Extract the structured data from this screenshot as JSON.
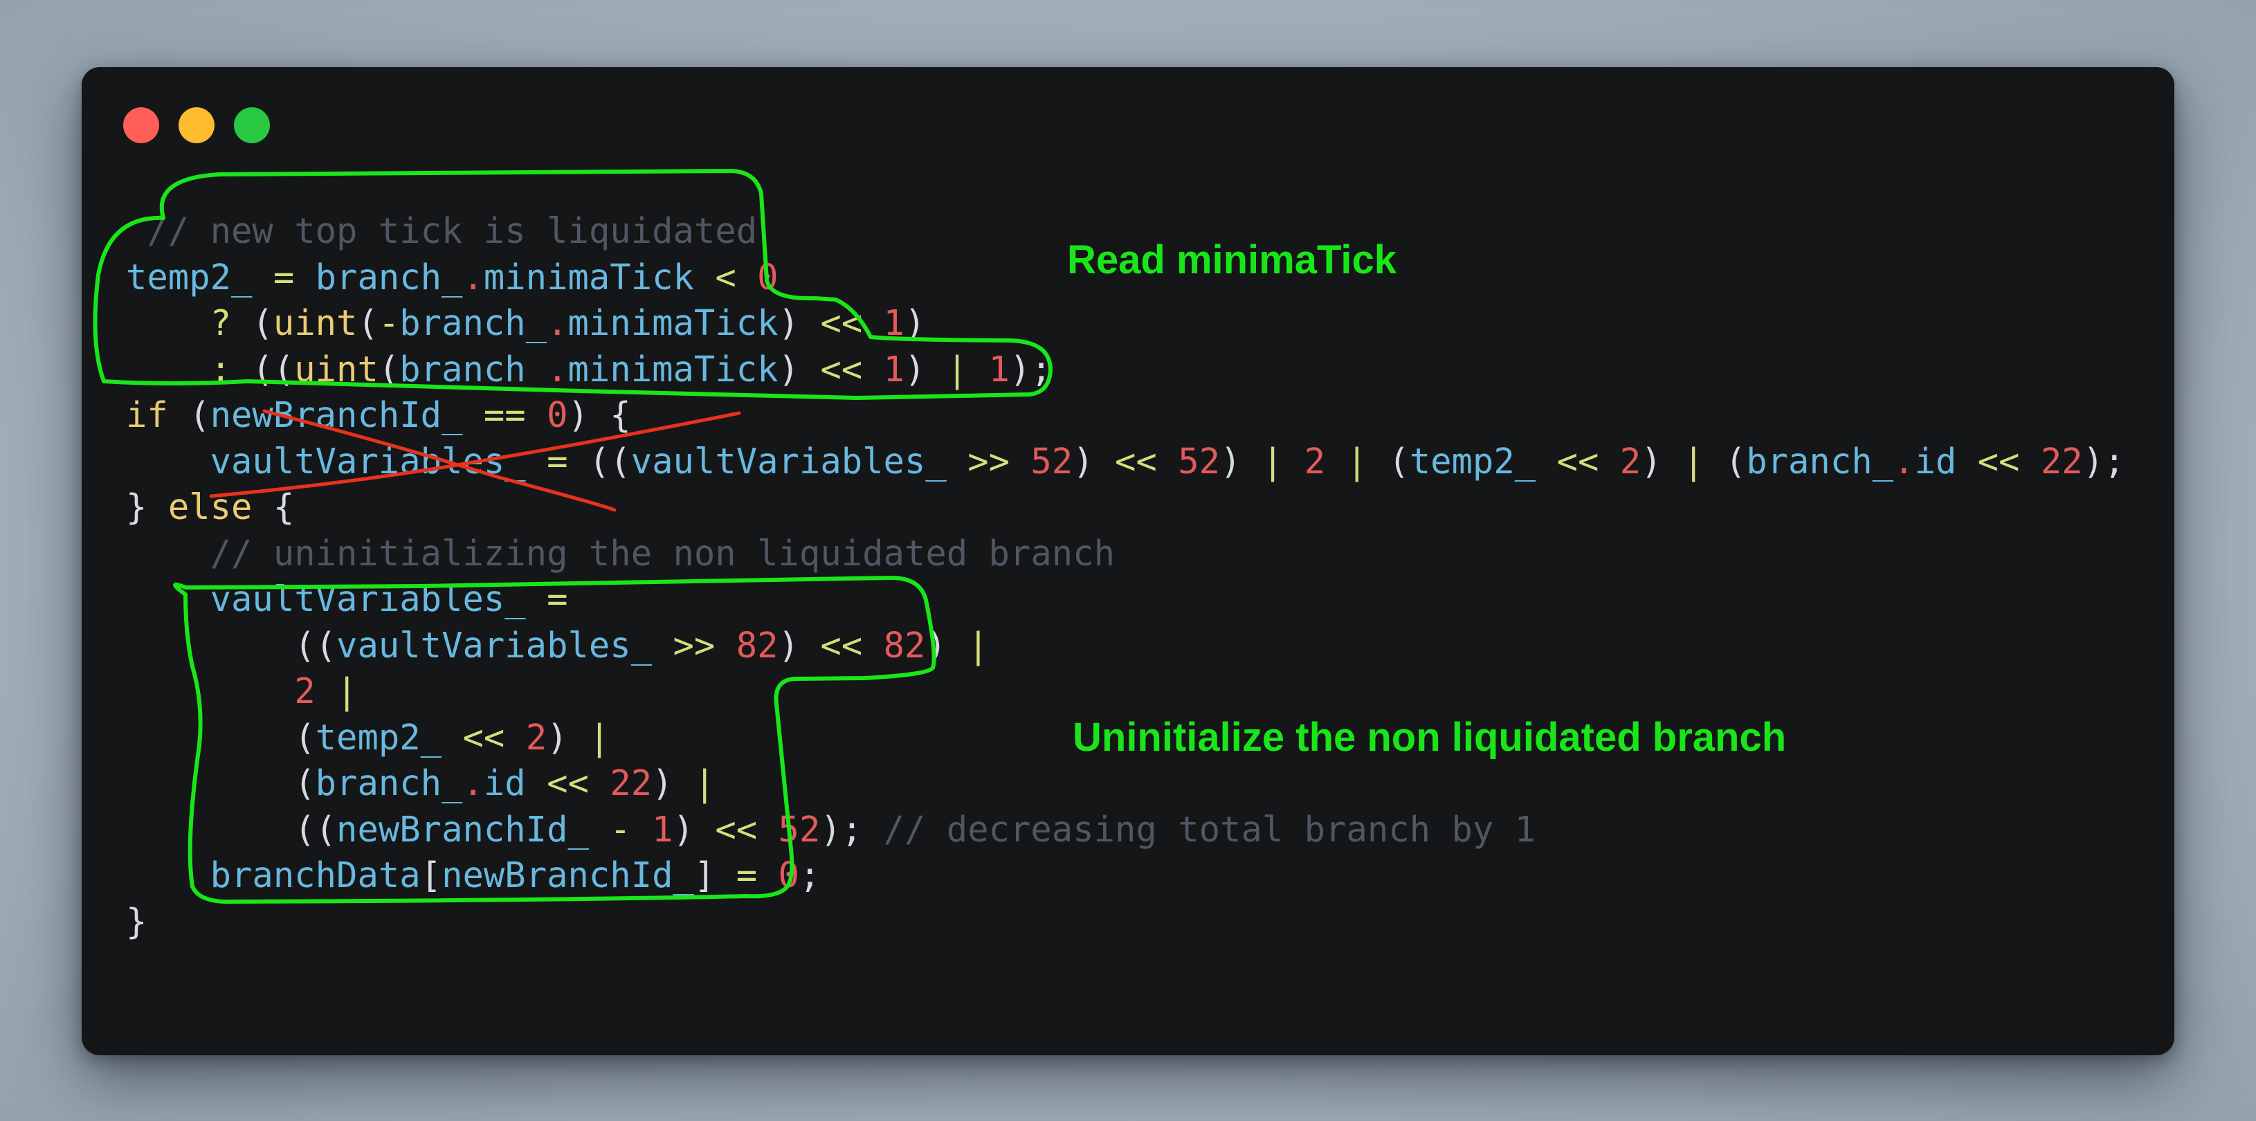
{
  "window": {
    "controls": [
      {
        "name": "close",
        "color": "#ff5f57"
      },
      {
        "name": "minimize",
        "color": "#febc2e"
      },
      {
        "name": "zoom",
        "color": "#28c840"
      }
    ]
  },
  "colors": {
    "annotation_green": "#19e619",
    "strike_red": "#e8321e"
  },
  "code": {
    "lines": [
      [
        [
          "cm",
          " // new top tick is liquidated"
        ]
      ],
      [
        [
          "id",
          "temp2_"
        ],
        [
          "pu",
          " "
        ],
        [
          "op",
          "="
        ],
        [
          "pu",
          " "
        ],
        [
          "id",
          "branch_"
        ],
        [
          "dt",
          "."
        ],
        [
          "id",
          "minimaTick"
        ],
        [
          "pu",
          " "
        ],
        [
          "op",
          "<"
        ],
        [
          "pu",
          " "
        ],
        [
          "nm",
          "0"
        ]
      ],
      [
        [
          "pu",
          "    "
        ],
        [
          "op",
          "?"
        ],
        [
          "pu",
          " ("
        ],
        [
          "fn",
          "uint"
        ],
        [
          "pu",
          "("
        ],
        [
          "op",
          "-"
        ],
        [
          "id",
          "branch_"
        ],
        [
          "dt",
          "."
        ],
        [
          "id",
          "minimaTick"
        ],
        [
          "pu",
          ") "
        ],
        [
          "op",
          "<<"
        ],
        [
          "pu",
          " "
        ],
        [
          "nm",
          "1"
        ],
        [
          "pu",
          ")"
        ]
      ],
      [
        [
          "pu",
          "    "
        ],
        [
          "op",
          ":"
        ],
        [
          "pu",
          " (("
        ],
        [
          "fn",
          "uint"
        ],
        [
          "pu",
          "("
        ],
        [
          "id",
          "branch_"
        ],
        [
          "dt",
          "."
        ],
        [
          "id",
          "minimaTick"
        ],
        [
          "pu",
          ") "
        ],
        [
          "op",
          "<<"
        ],
        [
          "pu",
          " "
        ],
        [
          "nm",
          "1"
        ],
        [
          "pu",
          ") "
        ],
        [
          "op",
          "|"
        ],
        [
          "pu",
          " "
        ],
        [
          "nm",
          "1"
        ],
        [
          "pu",
          ");"
        ]
      ],
      [
        [
          "kw",
          "if"
        ],
        [
          "pu",
          " ("
        ],
        [
          "id",
          "newBranchId_"
        ],
        [
          "pu",
          " "
        ],
        [
          "op",
          "=="
        ],
        [
          "pu",
          " "
        ],
        [
          "nm",
          "0"
        ],
        [
          "pu",
          ") {"
        ]
      ],
      [
        [
          "pu",
          "    "
        ],
        [
          "id",
          "vaultVariables_"
        ],
        [
          "pu",
          " "
        ],
        [
          "op",
          "="
        ],
        [
          "pu",
          " (("
        ],
        [
          "id",
          "vaultVariables_"
        ],
        [
          "pu",
          " "
        ],
        [
          "op",
          ">>"
        ],
        [
          "pu",
          " "
        ],
        [
          "nm",
          "52"
        ],
        [
          "pu",
          ") "
        ],
        [
          "op",
          "<<"
        ],
        [
          "pu",
          " "
        ],
        [
          "nm",
          "52"
        ],
        [
          "pu",
          ") "
        ],
        [
          "op",
          "|"
        ],
        [
          "pu",
          " "
        ],
        [
          "nm",
          "2"
        ],
        [
          "pu",
          " "
        ],
        [
          "op",
          "|"
        ],
        [
          "pu",
          " ("
        ],
        [
          "id",
          "temp2_"
        ],
        [
          "pu",
          " "
        ],
        [
          "op",
          "<<"
        ],
        [
          "pu",
          " "
        ],
        [
          "nm",
          "2"
        ],
        [
          "pu",
          ") "
        ],
        [
          "op",
          "|"
        ],
        [
          "pu",
          " ("
        ],
        [
          "id",
          "branch_"
        ],
        [
          "dt",
          "."
        ],
        [
          "id",
          "id"
        ],
        [
          "pu",
          " "
        ],
        [
          "op",
          "<<"
        ],
        [
          "pu",
          " "
        ],
        [
          "nm",
          "22"
        ],
        [
          "pu",
          ");"
        ]
      ],
      [
        [
          "pu",
          "} "
        ],
        [
          "kw",
          "else"
        ],
        [
          "pu",
          " {"
        ]
      ],
      [
        [
          "pu",
          "    "
        ],
        [
          "cm",
          "// uninitializing the non liquidated branch"
        ]
      ],
      [
        [
          "pu",
          "    "
        ],
        [
          "id",
          "vaultVariables_"
        ],
        [
          "pu",
          " "
        ],
        [
          "op",
          "="
        ]
      ],
      [
        [
          "pu",
          "        (("
        ],
        [
          "id",
          "vaultVariables_"
        ],
        [
          "pu",
          " "
        ],
        [
          "op",
          ">>"
        ],
        [
          "pu",
          " "
        ],
        [
          "nm",
          "82"
        ],
        [
          "pu",
          ") "
        ],
        [
          "op",
          "<<"
        ],
        [
          "pu",
          " "
        ],
        [
          "nm",
          "82"
        ],
        [
          "pu",
          ") "
        ],
        [
          "op",
          "|"
        ]
      ],
      [
        [
          "pu",
          "        "
        ],
        [
          "nm",
          "2"
        ],
        [
          "pu",
          " "
        ],
        [
          "op",
          "|"
        ]
      ],
      [
        [
          "pu",
          "        ("
        ],
        [
          "id",
          "temp2_"
        ],
        [
          "pu",
          " "
        ],
        [
          "op",
          "<<"
        ],
        [
          "pu",
          " "
        ],
        [
          "nm",
          "2"
        ],
        [
          "pu",
          ") "
        ],
        [
          "op",
          "|"
        ]
      ],
      [
        [
          "pu",
          "        ("
        ],
        [
          "id",
          "branch_"
        ],
        [
          "dt",
          "."
        ],
        [
          "id",
          "id"
        ],
        [
          "pu",
          " "
        ],
        [
          "op",
          "<<"
        ],
        [
          "pu",
          " "
        ],
        [
          "nm",
          "22"
        ],
        [
          "pu",
          ") "
        ],
        [
          "op",
          "|"
        ]
      ],
      [
        [
          "pu",
          "        (("
        ],
        [
          "id",
          "newBranchId_"
        ],
        [
          "pu",
          " "
        ],
        [
          "op",
          "-"
        ],
        [
          "pu",
          " "
        ],
        [
          "nm",
          "1"
        ],
        [
          "pu",
          ") "
        ],
        [
          "op",
          "<<"
        ],
        [
          "pu",
          " "
        ],
        [
          "nm",
          "52"
        ],
        [
          "pu",
          "); "
        ],
        [
          "cm",
          "// decreasing total branch by 1"
        ]
      ],
      [
        [
          "pu",
          "    "
        ],
        [
          "id",
          "branchData"
        ],
        [
          "br",
          "["
        ],
        [
          "id",
          "newBranchId_"
        ],
        [
          "br",
          "]"
        ],
        [
          "pu",
          " "
        ],
        [
          "op",
          "="
        ],
        [
          "pu",
          " "
        ],
        [
          "nm",
          "0"
        ],
        [
          "pu",
          ";"
        ]
      ],
      [
        [
          "pu",
          "}"
        ]
      ]
    ]
  },
  "annotations": {
    "read_label": "Read minimaTick",
    "uninit_label": "Uninitialize the non liquidated branch"
  }
}
